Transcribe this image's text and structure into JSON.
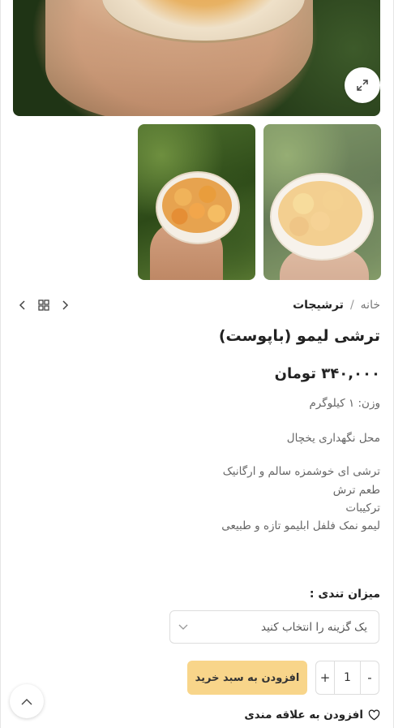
{
  "breadcrumb": {
    "home": "خانه",
    "separator": "/",
    "current": "ترشیجات"
  },
  "product": {
    "title": "ترشی لیمو (باپوست)",
    "price": "۳۴۰,۰۰۰ تومان",
    "weight": "وزن: ۱ کیلوگرم",
    "storage": "محل نگهداری یخچال",
    "description": [
      "ترشی ای خوشمزه سالم و ارگانیک",
      "طعم ترش",
      "ترکیبات",
      "لیمو نمک فلفل ابلیمو تازه و طبیعی"
    ]
  },
  "options": {
    "label": "میزان تندی :",
    "placeholder": "یک گزینه را انتخاب کنید"
  },
  "quantity": {
    "minus": "-",
    "value": "1",
    "plus": "+"
  },
  "add_to_cart": "افزودن به سبد خرید",
  "wishlist": "افزودن به علاقه مندی",
  "icons": {
    "expand": "expand-icon",
    "prev": "chevron-left-icon",
    "grid": "grid-icon",
    "next": "chevron-right-icon",
    "select": "chevron-down-icon",
    "scroll_top": "chevron-up-icon",
    "wishlist": "heart-icon"
  },
  "colors": {
    "add_to_cart_bg": "#f8d58a",
    "text": "#222222"
  }
}
